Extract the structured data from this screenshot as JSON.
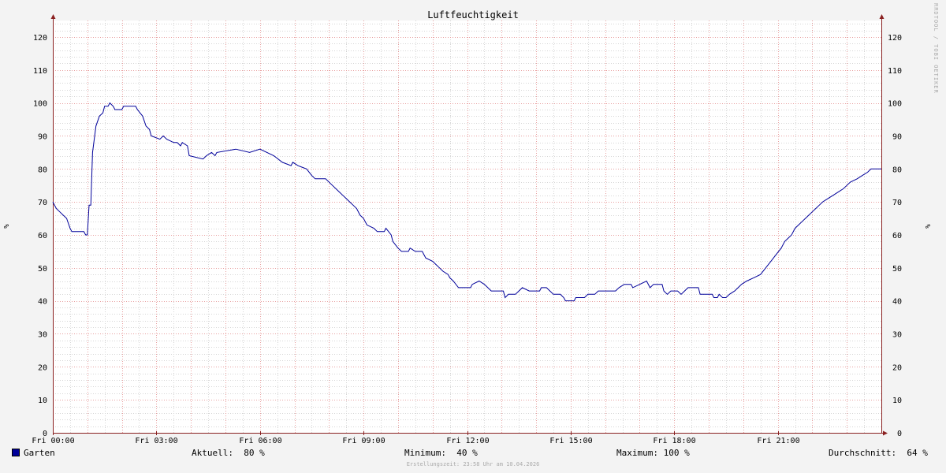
{
  "chart_data": {
    "type": "line",
    "title": "Luftfeuchtigkeit",
    "ylabel": "%",
    "ylim": [
      0,
      125
    ],
    "yticks": [
      0,
      10,
      20,
      30,
      40,
      50,
      60,
      70,
      80,
      90,
      100,
      110,
      120
    ],
    "xlim": [
      0,
      24
    ],
    "xticks": [
      {
        "hour": 0,
        "label": "Fri 00:00"
      },
      {
        "hour": 3,
        "label": "Fri 03:00"
      },
      {
        "hour": 6,
        "label": "Fri 06:00"
      },
      {
        "hour": 9,
        "label": "Fri 09:00"
      },
      {
        "hour": 12,
        "label": "Fri 12:00"
      },
      {
        "hour": 15,
        "label": "Fri 15:00"
      },
      {
        "hour": 18,
        "label": "Fri 18:00"
      },
      {
        "hour": 21,
        "label": "Fri 21:00"
      }
    ],
    "grid": true,
    "series": [
      {
        "name": "Garten",
        "color": "#00009a",
        "points": [
          [
            0.0,
            70
          ],
          [
            0.1,
            68
          ],
          [
            0.2,
            67
          ],
          [
            0.3,
            66
          ],
          [
            0.4,
            65
          ],
          [
            0.5,
            62
          ],
          [
            0.55,
            61
          ],
          [
            0.9,
            61
          ],
          [
            0.95,
            60
          ],
          [
            1.0,
            60
          ],
          [
            1.05,
            69
          ],
          [
            1.1,
            69
          ],
          [
            1.15,
            85
          ],
          [
            1.25,
            93
          ],
          [
            1.35,
            96
          ],
          [
            1.45,
            97
          ],
          [
            1.5,
            99
          ],
          [
            1.6,
            99
          ],
          [
            1.65,
            100
          ],
          [
            1.75,
            99
          ],
          [
            1.8,
            98
          ],
          [
            2.0,
            98
          ],
          [
            2.05,
            99
          ],
          [
            2.4,
            99
          ],
          [
            2.45,
            98
          ],
          [
            2.6,
            96
          ],
          [
            2.7,
            93
          ],
          [
            2.8,
            92
          ],
          [
            2.85,
            90
          ],
          [
            3.1,
            89
          ],
          [
            3.2,
            90
          ],
          [
            3.3,
            89
          ],
          [
            3.5,
            88
          ],
          [
            3.6,
            88
          ],
          [
            3.7,
            87
          ],
          [
            3.75,
            88
          ],
          [
            3.9,
            87
          ],
          [
            3.95,
            84
          ],
          [
            4.35,
            83
          ],
          [
            4.45,
            84
          ],
          [
            4.6,
            85
          ],
          [
            4.7,
            84
          ],
          [
            4.75,
            85
          ],
          [
            5.3,
            86
          ],
          [
            5.7,
            85
          ],
          [
            6.0,
            86
          ],
          [
            6.4,
            84
          ],
          [
            6.65,
            82
          ],
          [
            6.9,
            81
          ],
          [
            6.95,
            82
          ],
          [
            7.1,
            81
          ],
          [
            7.35,
            80
          ],
          [
            7.5,
            78
          ],
          [
            7.6,
            77
          ],
          [
            7.9,
            77
          ],
          [
            8.1,
            75
          ],
          [
            8.3,
            73
          ],
          [
            8.4,
            72
          ],
          [
            8.5,
            71
          ],
          [
            8.6,
            70
          ],
          [
            8.7,
            69
          ],
          [
            8.8,
            68
          ],
          [
            8.9,
            66
          ],
          [
            9.0,
            65
          ],
          [
            9.1,
            63
          ],
          [
            9.3,
            62
          ],
          [
            9.4,
            61
          ],
          [
            9.6,
            61
          ],
          [
            9.65,
            62
          ],
          [
            9.8,
            60
          ],
          [
            9.85,
            58
          ],
          [
            10.0,
            56
          ],
          [
            10.1,
            55
          ],
          [
            10.3,
            55
          ],
          [
            10.35,
            56
          ],
          [
            10.5,
            55
          ],
          [
            10.7,
            55
          ],
          [
            10.8,
            53
          ],
          [
            11.0,
            52
          ],
          [
            11.1,
            51
          ],
          [
            11.2,
            50
          ],
          [
            11.3,
            49
          ],
          [
            11.45,
            48
          ],
          [
            11.5,
            47
          ],
          [
            11.6,
            46
          ],
          [
            11.75,
            44
          ],
          [
            12.1,
            44
          ],
          [
            12.15,
            45
          ],
          [
            12.35,
            46
          ],
          [
            12.5,
            45
          ],
          [
            12.6,
            44
          ],
          [
            12.7,
            43
          ],
          [
            13.05,
            43
          ],
          [
            13.1,
            41
          ],
          [
            13.2,
            42
          ],
          [
            13.4,
            42
          ],
          [
            13.5,
            43
          ],
          [
            13.6,
            44
          ],
          [
            13.8,
            43
          ],
          [
            14.1,
            43
          ],
          [
            14.15,
            44
          ],
          [
            14.3,
            44
          ],
          [
            14.4,
            43
          ],
          [
            14.5,
            42
          ],
          [
            14.7,
            42
          ],
          [
            14.8,
            41
          ],
          [
            14.85,
            40
          ],
          [
            15.1,
            40
          ],
          [
            15.15,
            41
          ],
          [
            15.4,
            41
          ],
          [
            15.5,
            42
          ],
          [
            15.7,
            42
          ],
          [
            15.8,
            43
          ],
          [
            16.3,
            43
          ],
          [
            16.4,
            44
          ],
          [
            16.55,
            45
          ],
          [
            16.75,
            45
          ],
          [
            16.8,
            44
          ],
          [
            17.0,
            45
          ],
          [
            17.2,
            46
          ],
          [
            17.3,
            44
          ],
          [
            17.4,
            45
          ],
          [
            17.65,
            45
          ],
          [
            17.7,
            43
          ],
          [
            17.8,
            42
          ],
          [
            17.9,
            43
          ],
          [
            18.1,
            43
          ],
          [
            18.2,
            42
          ],
          [
            18.3,
            43
          ],
          [
            18.4,
            44
          ],
          [
            18.7,
            44
          ],
          [
            18.75,
            42
          ],
          [
            19.1,
            42
          ],
          [
            19.15,
            41
          ],
          [
            19.25,
            41
          ],
          [
            19.3,
            42
          ],
          [
            19.4,
            41
          ],
          [
            19.5,
            41
          ],
          [
            19.6,
            42
          ],
          [
            19.75,
            43
          ],
          [
            19.85,
            44
          ],
          [
            19.95,
            45
          ],
          [
            20.1,
            46
          ],
          [
            20.3,
            47
          ],
          [
            20.5,
            48
          ],
          [
            20.65,
            50
          ],
          [
            20.8,
            52
          ],
          [
            20.95,
            54
          ],
          [
            21.1,
            56
          ],
          [
            21.2,
            58
          ],
          [
            21.3,
            59
          ],
          [
            21.4,
            60
          ],
          [
            21.5,
            62
          ],
          [
            21.6,
            63
          ],
          [
            21.7,
            64
          ],
          [
            21.8,
            65
          ],
          [
            21.9,
            66
          ],
          [
            22.0,
            67
          ],
          [
            22.1,
            68
          ],
          [
            22.2,
            69
          ],
          [
            22.3,
            70
          ],
          [
            22.45,
            71
          ],
          [
            22.6,
            72
          ],
          [
            22.75,
            73
          ],
          [
            22.9,
            74
          ],
          [
            23.0,
            75
          ],
          [
            23.1,
            76
          ],
          [
            23.3,
            77
          ],
          [
            23.45,
            78
          ],
          [
            23.6,
            79
          ],
          [
            23.7,
            80
          ],
          [
            24.0,
            80
          ]
        ]
      }
    ]
  },
  "legend": {
    "series_name": "Garten",
    "aktuell": "Aktuell:  80 %",
    "minimum": "Minimum:  40 %",
    "maximum": "Maximum: 100 %",
    "durchschnitt": "Durchschnitt:  64 %"
  },
  "footer": "Erstellungszeit: 23:58 Uhr am 10.04.2026",
  "watermark": "RRDTOOL / TOBI OETIKER"
}
